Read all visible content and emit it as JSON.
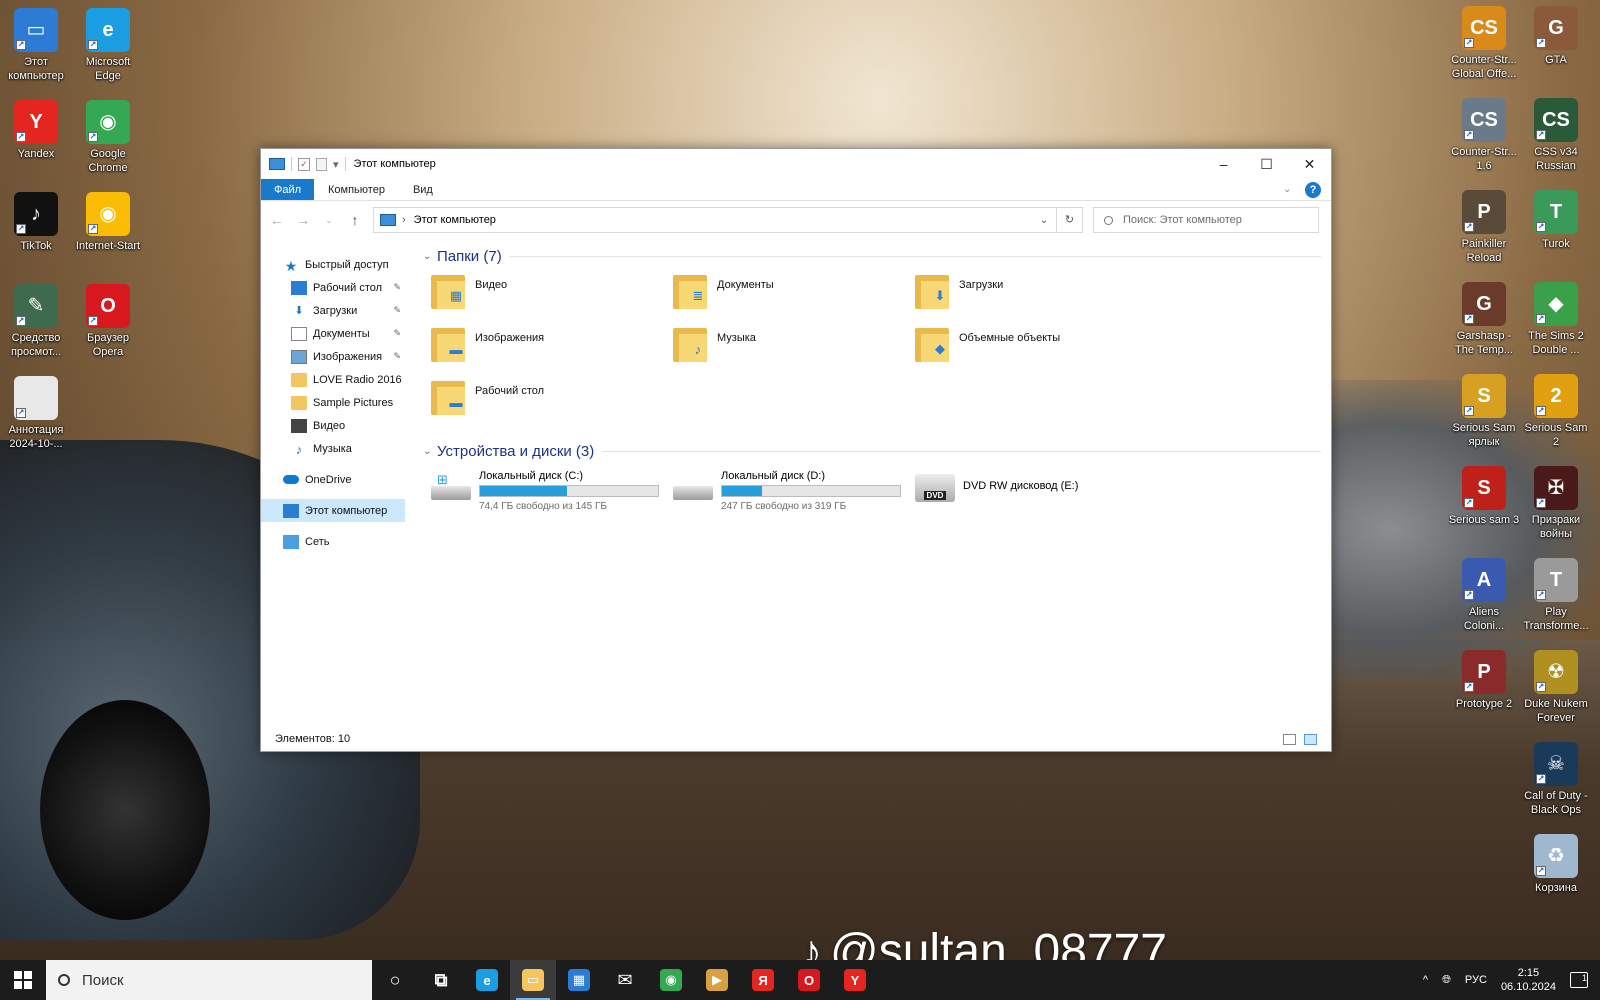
{
  "desktop": {
    "left_icons": [
      {
        "label": "Этот компьютер",
        "color": "#2d7bd4",
        "glyph": "▭"
      },
      {
        "label": "Microsoft Edge",
        "color": "#1b9de2",
        "glyph": "e"
      },
      {
        "label": "Yandex",
        "color": "#e52620",
        "glyph": "Y"
      },
      {
        "label": "Google Chrome",
        "color": "#34a853",
        "glyph": "◉"
      },
      {
        "label": "TikTok",
        "color": "#111111",
        "glyph": "♪"
      },
      {
        "label": "Internet-Start",
        "color": "#fbbc05",
        "glyph": "◉"
      },
      {
        "label": "Средство просмот...",
        "color": "#3e6b4e",
        "glyph": "✎"
      },
      {
        "label": "Браузер Opera",
        "color": "#d7191f",
        "glyph": "O"
      },
      {
        "label": "Аннотация 2024-10-...",
        "color": "#e8e8e8",
        "glyph": ""
      }
    ],
    "right_icons": [
      {
        "label": "Counter-Str... Global Offe...",
        "color": "#d98a1a",
        "glyph": "CS"
      },
      {
        "label": "GTA",
        "color": "#8a5a3a",
        "glyph": "G"
      },
      {
        "label": "Counter-Str... 1.6",
        "color": "#6a7a8a",
        "glyph": "CS"
      },
      {
        "label": "CSS v34 Russian",
        "color": "#2a5a3a",
        "glyph": "CS"
      },
      {
        "label": "Painkiller Reload",
        "color": "#5a4a3a",
        "glyph": "P"
      },
      {
        "label": "Turok",
        "color": "#3a9a5a",
        "glyph": "T"
      },
      {
        "label": "Garshasp - The Temp...",
        "color": "#6a3a2a",
        "glyph": "G"
      },
      {
        "label": "The Sims 2 Double ...",
        "color": "#3aa04a",
        "glyph": "◆"
      },
      {
        "label": "Serious Sam ярлык",
        "color": "#d8a020",
        "glyph": "S"
      },
      {
        "label": "Serious Sam 2",
        "color": "#e0a010",
        "glyph": "2"
      },
      {
        "label": "Serious sam 3",
        "color": "#c0201a",
        "glyph": "S"
      },
      {
        "label": "Призраки войны",
        "color": "#4a1a1a",
        "glyph": "✠"
      },
      {
        "label": "Aliens Coloni...",
        "color": "#3a5ab0",
        "glyph": "A"
      },
      {
        "label": "Play Transforme...",
        "color": "#9a9a9a",
        "glyph": "T"
      },
      {
        "label": "Prototype 2",
        "color": "#8a2a2a",
        "glyph": "P"
      },
      {
        "label": "Duke Nukem Forever",
        "color": "#b09020",
        "glyph": "☢"
      },
      {
        "label": "Call of Duty - Black Ops",
        "color": "#1a3a5a",
        "glyph": "☠"
      },
      {
        "label": "Корзина",
        "color": "#9fb8cf",
        "glyph": "♻"
      }
    ]
  },
  "window": {
    "title": "Этот компьютер",
    "ribbon": {
      "file": "Файл",
      "tabs": [
        "Компьютер",
        "Вид"
      ],
      "help": "?"
    },
    "address": "Этот компьютер",
    "search_placeholder": "Поиск: Этот компьютер",
    "nav": {
      "quick_access": "Быстрый доступ",
      "items": [
        {
          "label": "Рабочий стол",
          "icon": "desktop-icon",
          "pinned": true
        },
        {
          "label": "Загрузки",
          "icon": "downloads-icon",
          "pinned": true
        },
        {
          "label": "Документы",
          "icon": "documents-icon",
          "pinned": true
        },
        {
          "label": "Изображения",
          "icon": "pictures-icon",
          "pinned": true
        },
        {
          "label": "LOVE Radio 2016",
          "icon": "folder-icon",
          "pinned": false
        },
        {
          "label": "Sample Pictures",
          "icon": "folder-icon",
          "pinned": false
        },
        {
          "label": "Видео",
          "icon": "videos-icon",
          "pinned": false
        },
        {
          "label": "Музыка",
          "icon": "music-icon",
          "pinned": false
        }
      ],
      "onedrive": "OneDrive",
      "this_pc": "Этот компьютер",
      "network": "Сеть"
    },
    "folders_header": "Папки (7)",
    "folders": [
      {
        "label": "Видео",
        "overlay": "▦"
      },
      {
        "label": "Документы",
        "overlay": "≣"
      },
      {
        "label": "Загрузки",
        "overlay": "⬇"
      },
      {
        "label": "Изображения",
        "overlay": "▬"
      },
      {
        "label": "Музыка",
        "overlay": "♪"
      },
      {
        "label": "Объемные объекты",
        "overlay": "◆"
      },
      {
        "label": "Рабочий стол",
        "overlay": "▬"
      }
    ],
    "devices_header": "Устройства и диски (3)",
    "drives": [
      {
        "label": "Локальный диск (C:)",
        "free": "74,4 ГБ свободно из 145 ГБ",
        "used_fraction": 0.487,
        "system": true
      },
      {
        "label": "Локальный диск (D:)",
        "free": "247 ГБ свободно из 319 ГБ",
        "used_fraction": 0.226,
        "system": false
      },
      {
        "label": "DVD RW дисковод (E:)",
        "dvd": "DVD"
      }
    ],
    "status": "Элементов: 10"
  },
  "taskbar": {
    "search_placeholder": "Поиск",
    "apps": [
      {
        "name": "cortana",
        "glyph": "○",
        "color": "transparent"
      },
      {
        "name": "task-view",
        "glyph": "⧉",
        "color": "transparent"
      },
      {
        "name": "edge",
        "glyph": "e",
        "color": "#1b9de2"
      },
      {
        "name": "explorer",
        "glyph": "▭",
        "color": "#f4c660",
        "active": true
      },
      {
        "name": "store",
        "glyph": "▦",
        "color": "#2b7cd3"
      },
      {
        "name": "mail",
        "glyph": "✉",
        "color": "transparent"
      },
      {
        "name": "chrome",
        "glyph": "◉",
        "color": "#34a853"
      },
      {
        "name": "media",
        "glyph": "▶",
        "color": "#d8a040"
      },
      {
        "name": "yandex-browser",
        "glyph": "Я",
        "color": "#e52620"
      },
      {
        "name": "opera",
        "glyph": "O",
        "color": "#d7191f"
      },
      {
        "name": "yandex",
        "glyph": "Y",
        "color": "#e52620"
      }
    ],
    "lang": "РУС",
    "time": "2:15",
    "date": "06.10.2024",
    "notifications": "1"
  },
  "watermark": "@sultan_08777"
}
